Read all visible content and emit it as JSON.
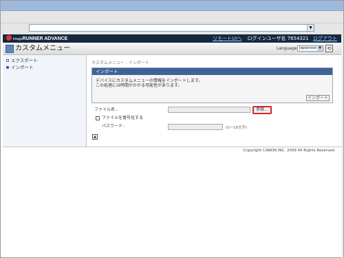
{
  "browser": {
    "address_dropdown": "▼"
  },
  "brand": {
    "name": "imageRUNNER ADVANCE",
    "prefix": "image",
    "suffix": "RUNNER ADVANCE",
    "logo_color": "#d33333"
  },
  "toplinks": {
    "remote_ui": "リモートUIへ",
    "login_user": "ログインユーザ名 7654321",
    "logout": "ログアウト"
  },
  "header": {
    "icon": "custom-menu-icon",
    "title": "カスタムメニュー",
    "language_label": "Language",
    "language_value": "Japanese",
    "language_dropdown": "▼",
    "refresh_icon": "⟲"
  },
  "sidebar": {
    "items": [
      {
        "label": "エクスポート",
        "active": false
      },
      {
        "label": "インポート",
        "active": true
      }
    ]
  },
  "main": {
    "breadcrumb": "カスタムメニュー : インポート",
    "panel_title": "インポート",
    "panel_messages": [
      "デバイスにカスタムメニューの情報をインポートします。",
      "この処理には時間がかかる可能性があります。"
    ],
    "import_button": "インポート",
    "file_label": "ファイル名 :",
    "browse_button": "参照...",
    "decrypt_label": "ファイルを復号化する",
    "password_label": "パスワード :",
    "password_hint": "(0～16文字)",
    "top_button": "▲"
  },
  "footer": {
    "copyright": "Copyright CANON INC. 2009 All Rights Reserved"
  },
  "colors": {
    "brand_bar": "#15283f",
    "panel_header": "#3e6397",
    "highlight": "#dd2222"
  }
}
